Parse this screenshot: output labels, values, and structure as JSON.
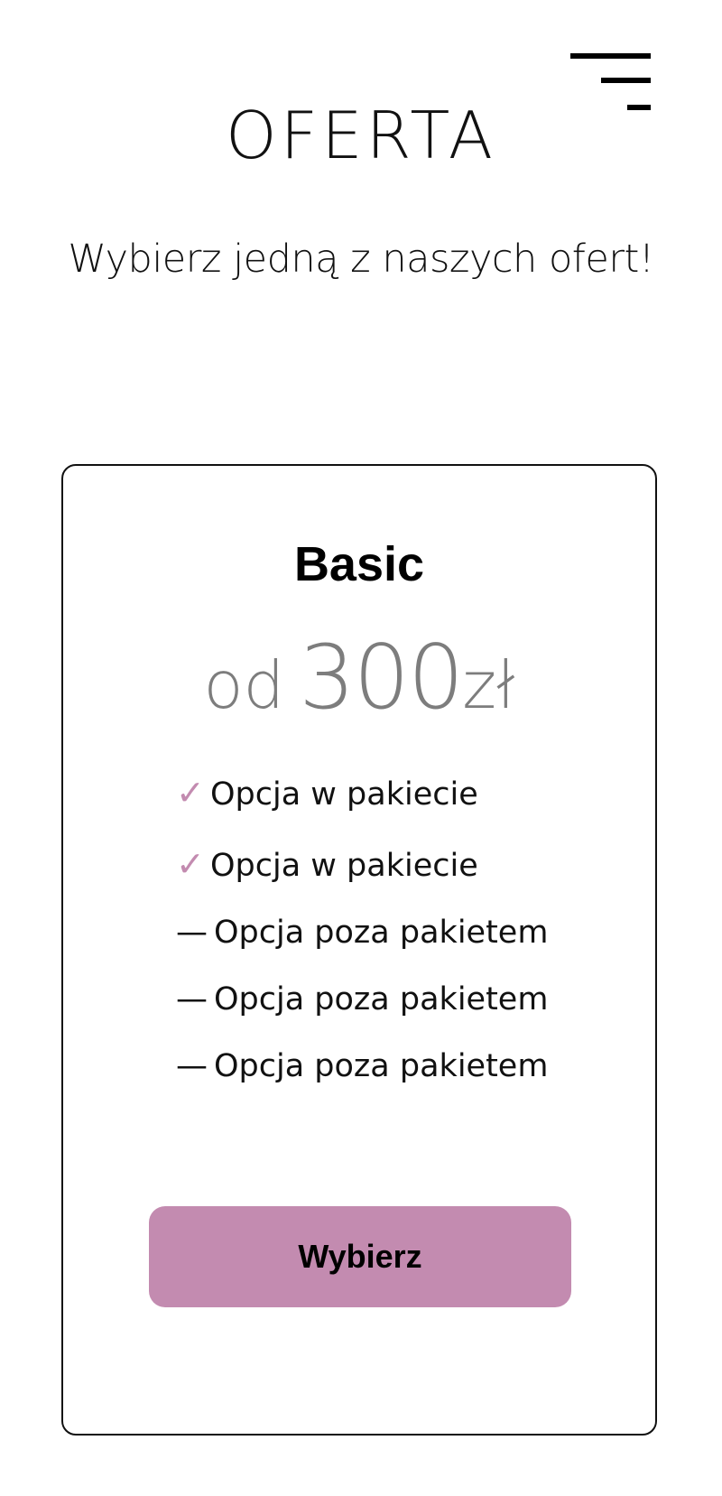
{
  "header": {
    "title": "OFERTA",
    "menu_icon": "hamburger-menu-icon"
  },
  "intro": {
    "subtitle": "Wybierz jedną z naszych ofert!"
  },
  "offer": {
    "name": "Basic",
    "price_prefix": "od",
    "price_amount": "300",
    "price_currency": "zł",
    "features": [
      {
        "mark": "✓",
        "mark_type": "check-icon",
        "label": "Opcja w pakiecie"
      },
      {
        "mark": "✓",
        "mark_type": "check-icon",
        "label": "Opcja w pakiecie"
      },
      {
        "mark": "—",
        "mark_type": "dash-icon",
        "label": "Opcja poza pakietem"
      },
      {
        "mark": "—",
        "mark_type": "dash-icon",
        "label": "Opcja poza pakietem"
      },
      {
        "mark": "—",
        "mark_type": "dash-icon",
        "label": "Opcja poza pakietem"
      }
    ],
    "button_label": "Wybierz"
  },
  "colors": {
    "accent": "#c38bb0",
    "price": "#7d7d7d",
    "text": "#111111"
  }
}
